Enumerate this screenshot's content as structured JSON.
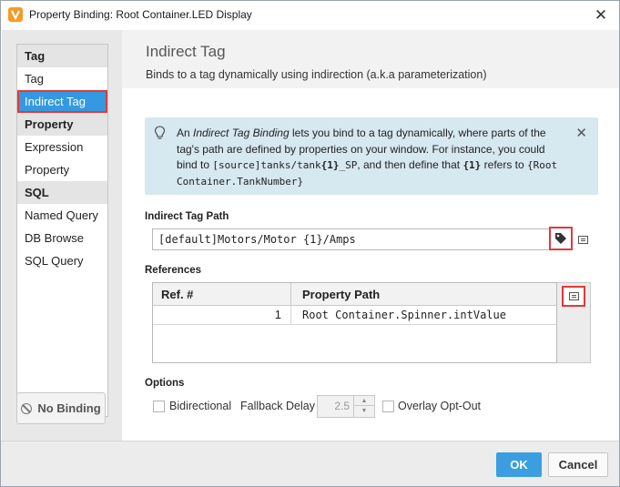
{
  "window": {
    "title": "Property Binding: Root Container.LED Display",
    "close_icon": "close-icon"
  },
  "sidebar": {
    "groups": [
      {
        "header": "Tag",
        "items": [
          "Tag",
          "Indirect Tag"
        ]
      },
      {
        "header": "Property",
        "items": [
          "Expression",
          "Property"
        ]
      },
      {
        "header": "SQL",
        "items": [
          "Named Query",
          "DB Browse",
          "SQL Query"
        ]
      }
    ],
    "selected": "Indirect Tag",
    "no_binding_label": "No Binding"
  },
  "header": {
    "title": "Indirect Tag",
    "subtitle": "Binds to a tag dynamically using indirection (a.k.a parameterization)"
  },
  "info": {
    "p1": "An ",
    "em": "Indirect Tag Binding",
    "p2": " lets you bind to a tag dynamically, where parts of the tag's path are defined by properties on your window. For instance, you could bind to ",
    "code1a": "[source]tanks/tank",
    "code1b": "{1}",
    "code1c": "_SP",
    "p3": ", and then define that ",
    "bold2": "{1}",
    "p4": " refers to ",
    "code2": "{Root Container.TankNumber}"
  },
  "path": {
    "label": "Indirect Tag Path",
    "value": "[default]Motors/Motor {1}/Amps"
  },
  "references": {
    "label": "References",
    "columns": [
      "Ref. #",
      "Property Path"
    ],
    "rows": [
      {
        "ref": "1",
        "path": "Root Container.Spinner.intValue"
      }
    ]
  },
  "options": {
    "label": "Options",
    "bidirectional": "Bidirectional",
    "fallback_delay_label": "Fallback Delay",
    "fallback_delay_value": "2.5",
    "overlay_opt_out": "Overlay Opt-Out"
  },
  "footer": {
    "ok": "OK",
    "cancel": "Cancel"
  },
  "colors": {
    "selected": "#3399e0",
    "highlight": "#e23a3a",
    "ok_button": "#3b9ee0",
    "info_bg": "#d6e8f0"
  }
}
